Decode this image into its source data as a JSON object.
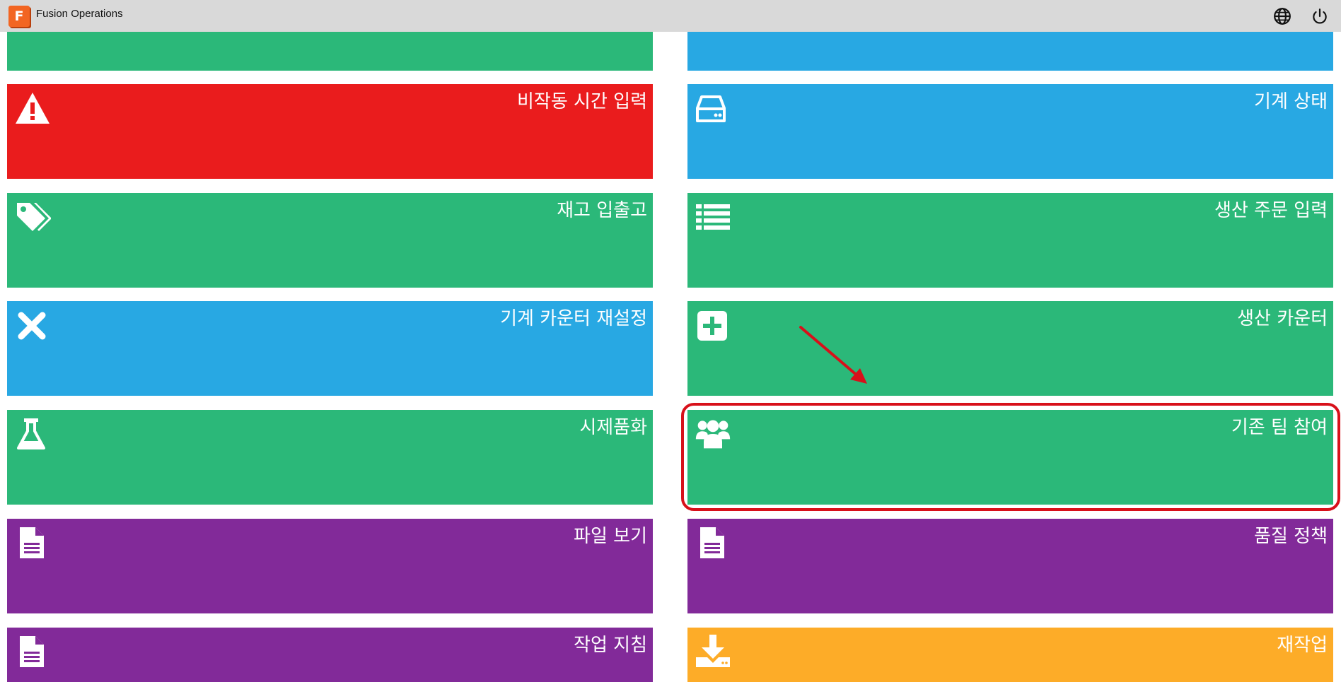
{
  "window": {
    "app_logo_letter": "F",
    "title": "Fusion Operations"
  },
  "tiles": {
    "top_left": {
      "label": "",
      "color": "#2bb879"
    },
    "top_right": {
      "label": "",
      "color": "#28a8e3"
    },
    "downtime": {
      "label": "비작동 시간 입력",
      "icon": "warning-icon",
      "color": "#ea1c1d"
    },
    "machine_status": {
      "label": "기계 상태",
      "icon": "hard-drive-icon",
      "color": "#28a8e3"
    },
    "inventory": {
      "label": "재고 입출고",
      "icon": "tags-icon",
      "color": "#2bb879"
    },
    "production_order": {
      "label": "생산 주문 입력",
      "icon": "list-icon",
      "color": "#2bb879"
    },
    "counter_reset": {
      "label": "기계 카운터 재설정",
      "icon": "close-icon",
      "color": "#28a8e3"
    },
    "production_counter": {
      "label": "생산 카운터",
      "icon": "plus-square-icon",
      "color": "#2bb879"
    },
    "prototype": {
      "label": "시제품화",
      "icon": "flask-icon",
      "color": "#2bb879"
    },
    "join_team": {
      "label": "기존 팀 참여",
      "icon": "users-icon",
      "color": "#2bb879"
    },
    "view_files": {
      "label": "파일 보기",
      "icon": "document-icon",
      "color": "#822a99"
    },
    "quality_policy": {
      "label": "품질 정책",
      "icon": "document-icon",
      "color": "#822a99"
    },
    "work_instructions": {
      "label": "작업 지침",
      "icon": "document-icon",
      "color": "#822a99"
    },
    "rework": {
      "label": "재작업",
      "icon": "download-icon",
      "color": "#fdac28"
    }
  },
  "annotation": {
    "highlight_color": "#d8101a"
  }
}
